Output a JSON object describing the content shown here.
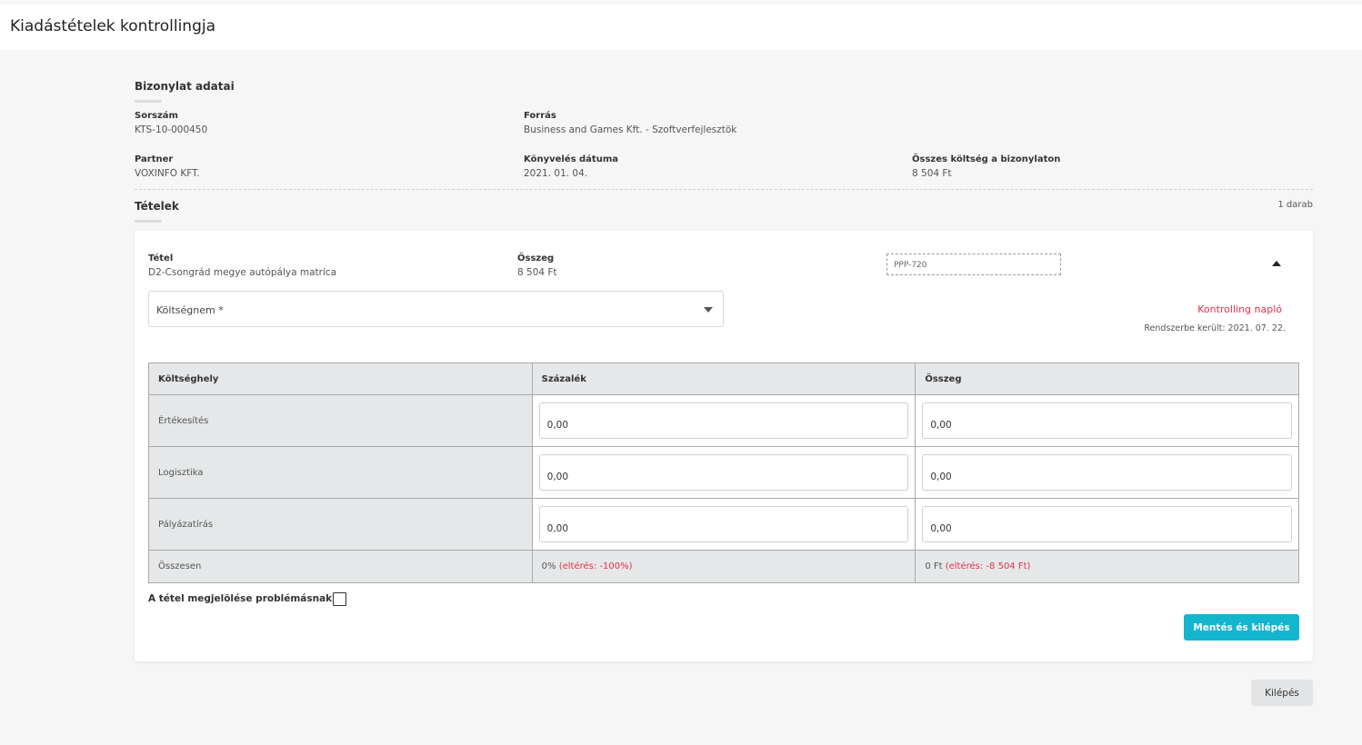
{
  "header": {
    "title": "Kiadástételek kontrollingja"
  },
  "document": {
    "section_title": "Bizonylat adatai",
    "serial": {
      "label": "Sorszám",
      "value": "KTS-10-000450"
    },
    "source": {
      "label": "Forrás",
      "value": "Business and Games Kft. - Szoftverfejlesztök"
    },
    "partner": {
      "label": "Partner",
      "value": "VOXINFO KFT."
    },
    "booking_date": {
      "label": "Könyvelés dátuma",
      "value": "2021. 01. 04."
    },
    "total_cost": {
      "label": "Összes költség a bizonylaton",
      "value": "8 504 Ft"
    }
  },
  "items": {
    "section_title": "Tételek",
    "count": "1 darab",
    "item": {
      "name_label": "Tétel",
      "name_value": "D2-Csongrád megye autópálya matrica",
      "amount_label": "Összeg",
      "amount_value": "8 504 Ft",
      "code": "PPP-720",
      "cost_type_label": "Költségnem *",
      "log_link": "Kontrolling napló",
      "registered": "Rendszerbe került: 2021. 07. 22.",
      "table": {
        "headers": [
          "Költséghely",
          "Százalék",
          "Összeg"
        ],
        "rows": [
          {
            "place": "Értékesítés",
            "percent": "0,00",
            "amount": "0,00"
          },
          {
            "place": "Logisztika",
            "percent": "0,00",
            "amount": "0,00"
          },
          {
            "place": "Pályázatírás",
            "percent": "0,00",
            "amount": "0,00"
          }
        ],
        "total": {
          "label": "Összesen",
          "percent": "0%",
          "percent_deviation": "(eltérés: -100%)",
          "amount": "0 Ft",
          "amount_deviation": "(eltérés: -8 504 Ft)"
        }
      },
      "problem_label": "A tétel megjelölése problémásnak",
      "save_button": "Mentés és kilépés"
    }
  },
  "exit_button": "Kilépés",
  "colors": {
    "accent": "#13b5cf",
    "error": "#e0334b",
    "table_bg": "#e5e7e8"
  }
}
